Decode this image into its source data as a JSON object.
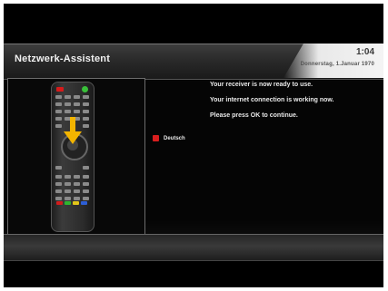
{
  "header": {
    "title": "Netzwerk-Assistent",
    "time": "1:04",
    "date": "Donnerstag, 1.Januar 1970"
  },
  "messages": [
    "Your receiver is now ready to use.",
    "Your internet connection is working now.",
    "Please press OK to continue."
  ],
  "language": {
    "label": "Deutsch",
    "color": "#d81e1e"
  },
  "remote": {
    "icon": "remote-control-icon",
    "arrow_icon": "down-arrow-icon",
    "arrow_color": "#f2b400"
  },
  "colors": {
    "background": "#000000",
    "text": "#e8e8e8",
    "header": "#2a2a2a",
    "clock_panel": "#f0f0f0"
  }
}
